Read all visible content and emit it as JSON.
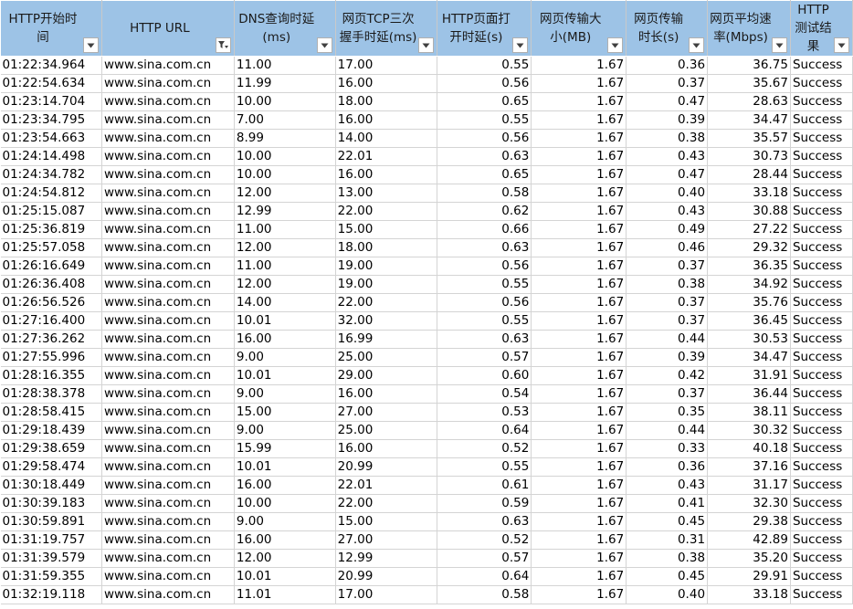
{
  "headers": [
    {
      "label": "HTTP开始时间",
      "filter": "dropdown"
    },
    {
      "label": "HTTP URL",
      "filter": "filtered"
    },
    {
      "label": "DNS查询时延(ms)",
      "filter": "dropdown"
    },
    {
      "label": "网页TCP三次握手时延(ms)",
      "filter": "dropdown"
    },
    {
      "label": "HTTP页面打开时延(s)",
      "filter": "dropdown"
    },
    {
      "label": "网页传输大小(MB)",
      "filter": "dropdown"
    },
    {
      "label": "网页传输时长(s)",
      "filter": "dropdown"
    },
    {
      "label": "网页平均速率(Mbps)",
      "filter": "dropdown"
    },
    {
      "label": "HTTP测试结果",
      "filter": "dropdown"
    }
  ],
  "rows": [
    [
      "01:22:34.964",
      "www.sina.com.cn",
      "11.00",
      "17.00",
      "0.55",
      "1.67",
      "0.36",
      "36.75",
      "Success"
    ],
    [
      "01:22:54.634",
      "www.sina.com.cn",
      "11.99",
      "16.00",
      "0.56",
      "1.67",
      "0.37",
      "35.67",
      "Success"
    ],
    [
      "01:23:14.704",
      "www.sina.com.cn",
      "10.00",
      "18.00",
      "0.65",
      "1.67",
      "0.47",
      "28.63",
      "Success"
    ],
    [
      "01:23:34.795",
      "www.sina.com.cn",
      "7.00",
      "16.00",
      "0.55",
      "1.67",
      "0.39",
      "34.47",
      "Success"
    ],
    [
      "01:23:54.663",
      "www.sina.com.cn",
      "8.99",
      "14.00",
      "0.56",
      "1.67",
      "0.38",
      "35.57",
      "Success"
    ],
    [
      "01:24:14.498",
      "www.sina.com.cn",
      "10.00",
      "22.01",
      "0.63",
      "1.67",
      "0.43",
      "30.73",
      "Success"
    ],
    [
      "01:24:34.782",
      "www.sina.com.cn",
      "10.00",
      "16.00",
      "0.65",
      "1.67",
      "0.47",
      "28.44",
      "Success"
    ],
    [
      "01:24:54.812",
      "www.sina.com.cn",
      "12.00",
      "13.00",
      "0.58",
      "1.67",
      "0.40",
      "33.18",
      "Success"
    ],
    [
      "01:25:15.087",
      "www.sina.com.cn",
      "12.99",
      "22.00",
      "0.62",
      "1.67",
      "0.43",
      "30.88",
      "Success"
    ],
    [
      "01:25:36.819",
      "www.sina.com.cn",
      "11.00",
      "15.00",
      "0.66",
      "1.67",
      "0.49",
      "27.22",
      "Success"
    ],
    [
      "01:25:57.058",
      "www.sina.com.cn",
      "12.00",
      "18.00",
      "0.63",
      "1.67",
      "0.46",
      "29.32",
      "Success"
    ],
    [
      "01:26:16.649",
      "www.sina.com.cn",
      "11.00",
      "19.00",
      "0.56",
      "1.67",
      "0.37",
      "36.35",
      "Success"
    ],
    [
      "01:26:36.408",
      "www.sina.com.cn",
      "12.00",
      "19.00",
      "0.55",
      "1.67",
      "0.38",
      "34.92",
      "Success"
    ],
    [
      "01:26:56.526",
      "www.sina.com.cn",
      "14.00",
      "22.00",
      "0.56",
      "1.67",
      "0.37",
      "35.76",
      "Success"
    ],
    [
      "01:27:16.400",
      "www.sina.com.cn",
      "10.01",
      "32.00",
      "0.55",
      "1.67",
      "0.37",
      "36.45",
      "Success"
    ],
    [
      "01:27:36.262",
      "www.sina.com.cn",
      "16.00",
      "16.99",
      "0.63",
      "1.67",
      "0.44",
      "30.53",
      "Success"
    ],
    [
      "01:27:55.996",
      "www.sina.com.cn",
      "9.00",
      "25.00",
      "0.57",
      "1.67",
      "0.39",
      "34.47",
      "Success"
    ],
    [
      "01:28:16.355",
      "www.sina.com.cn",
      "10.01",
      "29.00",
      "0.60",
      "1.67",
      "0.42",
      "31.91",
      "Success"
    ],
    [
      "01:28:38.378",
      "www.sina.com.cn",
      "9.00",
      "16.00",
      "0.54",
      "1.67",
      "0.37",
      "36.44",
      "Success"
    ],
    [
      "01:28:58.415",
      "www.sina.com.cn",
      "15.00",
      "27.00",
      "0.53",
      "1.67",
      "0.35",
      "38.11",
      "Success"
    ],
    [
      "01:29:18.439",
      "www.sina.com.cn",
      "9.00",
      "25.00",
      "0.64",
      "1.67",
      "0.44",
      "30.32",
      "Success"
    ],
    [
      "01:29:38.659",
      "www.sina.com.cn",
      "15.99",
      "16.00",
      "0.52",
      "1.67",
      "0.33",
      "40.18",
      "Success"
    ],
    [
      "01:29:58.474",
      "www.sina.com.cn",
      "10.01",
      "20.99",
      "0.55",
      "1.67",
      "0.36",
      "37.16",
      "Success"
    ],
    [
      "01:30:18.449",
      "www.sina.com.cn",
      "16.00",
      "22.01",
      "0.61",
      "1.67",
      "0.43",
      "31.17",
      "Success"
    ],
    [
      "01:30:39.183",
      "www.sina.com.cn",
      "10.00",
      "22.00",
      "0.59",
      "1.67",
      "0.41",
      "32.30",
      "Success"
    ],
    [
      "01:30:59.891",
      "www.sina.com.cn",
      "9.00",
      "15.00",
      "0.63",
      "1.67",
      "0.45",
      "29.38",
      "Success"
    ],
    [
      "01:31:19.757",
      "www.sina.com.cn",
      "16.00",
      "27.00",
      "0.52",
      "1.67",
      "0.31",
      "42.89",
      "Success"
    ],
    [
      "01:31:39.579",
      "www.sina.com.cn",
      "12.00",
      "12.99",
      "0.57",
      "1.67",
      "0.38",
      "35.20",
      "Success"
    ],
    [
      "01:31:59.355",
      "www.sina.com.cn",
      "10.01",
      "20.99",
      "0.64",
      "1.67",
      "0.45",
      "29.91",
      "Success"
    ],
    [
      "01:32:19.118",
      "www.sina.com.cn",
      "11.01",
      "17.00",
      "0.58",
      "1.67",
      "0.40",
      "33.18",
      "Success"
    ]
  ],
  "colors": {
    "header_bg": "#9dc3e6",
    "grid_line": "#d4d4d4",
    "selection_accent": "#217346"
  }
}
